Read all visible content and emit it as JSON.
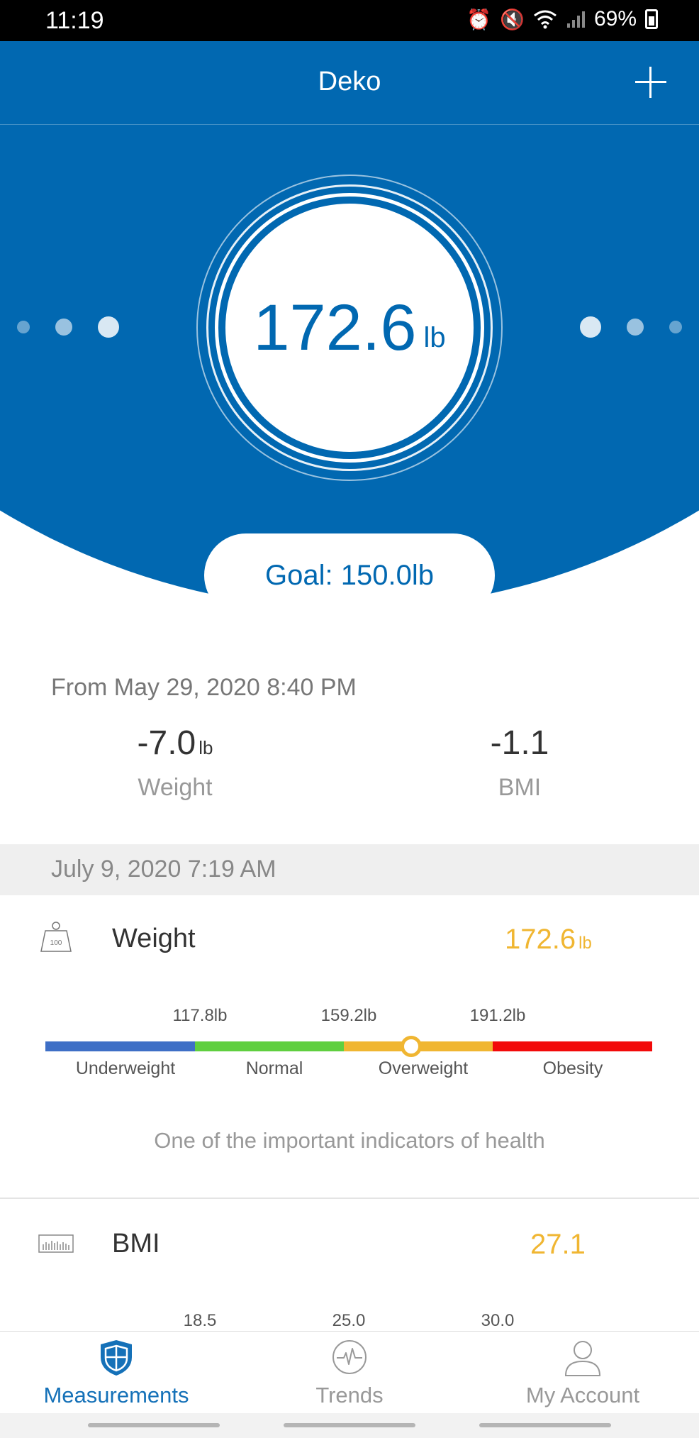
{
  "status_bar": {
    "time": "11:19",
    "battery": "69%"
  },
  "header": {
    "title": "Deko"
  },
  "hero": {
    "weight_value": "172.6",
    "weight_unit": "lb",
    "goal": "Goal: 150.0lb"
  },
  "change": {
    "from_text": "From May 29, 2020 8:40 PM",
    "weight_delta": "-7.0",
    "weight_delta_unit": "lb",
    "weight_label": "Weight",
    "bmi_delta": "-1.1",
    "bmi_label": "BMI"
  },
  "measurement_date": "July 9, 2020 7:19 AM",
  "weight_metric": {
    "name": "Weight",
    "value": "172.6",
    "unit": "lb",
    "icon_text": "100",
    "thresholds": [
      "117.8lb",
      "159.2lb",
      "191.2lb"
    ],
    "categories": [
      "Underweight",
      "Normal",
      "Overweight",
      "Obesity"
    ],
    "category_colors": [
      "#3e6fc6",
      "#5fcf3f",
      "#f0b632",
      "#f20a0a"
    ],
    "current_category": "Overweight",
    "description": "One of the important indicators of health"
  },
  "bmi_metric": {
    "name": "BMI",
    "value": "27.1",
    "thresholds": [
      "18.5",
      "25.0",
      "30.0"
    ]
  },
  "bottom_nav": {
    "items": [
      {
        "label": "Measurements",
        "icon": "shield-icon",
        "active": true
      },
      {
        "label": "Trends",
        "icon": "pulse-icon",
        "active": false
      },
      {
        "label": "My Account",
        "icon": "person-icon",
        "active": false
      }
    ],
    "active_color": "#1571b8",
    "inactive_color": "#999999"
  }
}
